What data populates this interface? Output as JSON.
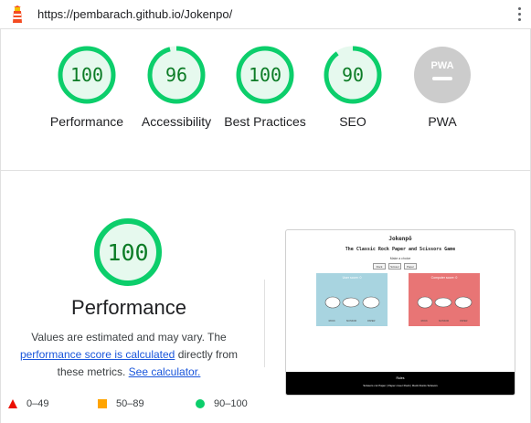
{
  "browser": {
    "url": "https://pembarach.github.io/Jokenpo/"
  },
  "gauges": [
    {
      "score": "100",
      "label": "Performance",
      "value": 1.0
    },
    {
      "score": "96",
      "label": "Accessibility",
      "value": 0.96
    },
    {
      "score": "100",
      "label": "Best Practices",
      "value": 1.0
    },
    {
      "score": "90",
      "label": "SEO",
      "value": 0.9
    },
    {
      "score": "PWA",
      "label": "PWA",
      "value": null
    }
  ],
  "performance": {
    "score": "100",
    "title": "Performance",
    "desc_start": "Values are estimated and may vary. The ",
    "desc_link1": "performance score is calculated",
    "desc_mid": " directly from these metrics. ",
    "desc_link2": "See calculator."
  },
  "legend": [
    {
      "range": "0–49",
      "color": "#eb0f00",
      "shape": "triangle"
    },
    {
      "range": "50–89",
      "color": "#ffa400",
      "shape": "square"
    },
    {
      "range": "90–100",
      "color": "#0cce6b",
      "shape": "circle"
    }
  ],
  "colors": {
    "pass_ring": "#0cce6b",
    "pass_fill": "#e6f9ee",
    "pass_text": "#0c7c26",
    "pwa_grey": "#cccccc"
  },
  "thumbnail": {
    "title": "Jokenpô",
    "subtitle": "The Classic Rock Paper and Scissors Game",
    "make_choice": "Make a choice",
    "buttons": [
      "Rock",
      "Scissor",
      "Paper"
    ],
    "user_score": "User score: 0",
    "computer_score": "Computer score: 0",
    "panel_buttons": [
      "ROCK",
      "SCISSOR",
      "PAPER"
    ],
    "footer_title": "Rules",
    "footer_text": "Scissors cut Paper | Paper cover Rock | Rock blunts Scissors",
    "user_color": "#a8d4e0",
    "computer_color": "#e87575"
  }
}
